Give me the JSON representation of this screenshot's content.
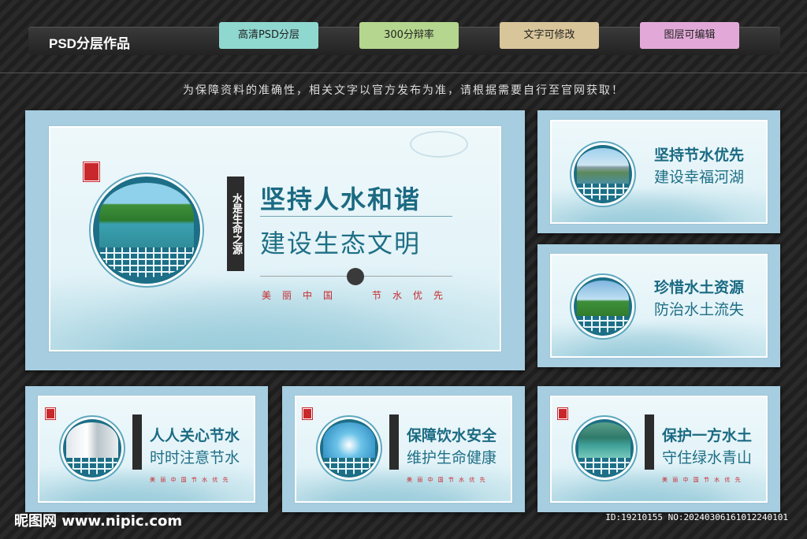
{
  "header": {
    "title": "PSD分层作品",
    "tags": [
      {
        "label": "高清PSD分层",
        "color": "#8fd8d0"
      },
      {
        "label": "300分辩率",
        "color": "#b5d68e"
      },
      {
        "label": "文字可修改",
        "color": "#d8c59a"
      },
      {
        "label": "图层可编辑",
        "color": "#e2a9d8"
      }
    ]
  },
  "notice": "为保障资料的准确性，相关文字以官方发布为准，请根据需要自行至官网获取！",
  "boards": [
    {
      "line1": "坚持人水和谐",
      "line2": "建设生态文明",
      "vertical": "水是生命之源",
      "red_left": "美丽中国",
      "red_right": "节水优先",
      "photo": "lake-forest"
    },
    {
      "line1": "坚持节水优先",
      "line2": "建设幸福河湖",
      "photo": "city-river"
    },
    {
      "line1": "珍惜水土资源",
      "line2": "防治水土流失",
      "photo": "grassland"
    },
    {
      "line1": "人人关心节水",
      "line2": "时时注意节水",
      "photo": "faucet"
    },
    {
      "line1": "保障饮水安全",
      "line2": "维护生命健康",
      "photo": "water-splash"
    },
    {
      "line1": "保护一方水土",
      "line2": "守住绿水青山",
      "photo": "green-lake"
    }
  ],
  "small_red": "美 丽 中 国   节 水 优 先",
  "footer": {
    "brand": "昵图网 www.nipic.com",
    "id_text": "ID:19210155 NO:20240306161012240101"
  }
}
